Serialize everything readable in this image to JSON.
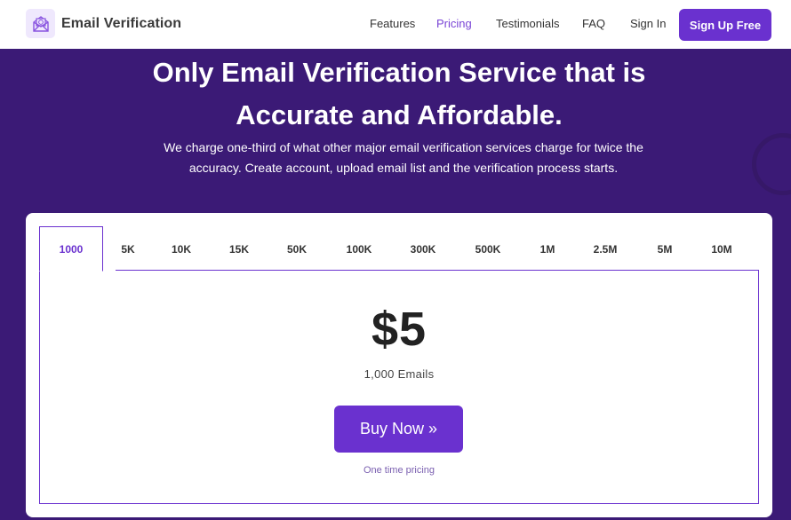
{
  "brand": {
    "name": "Email Verification",
    "logo_icon": "envelope-check-icon"
  },
  "nav": {
    "links": [
      {
        "label": "Features",
        "active": false
      },
      {
        "label": "Pricing",
        "active": true
      },
      {
        "label": "Testimonials",
        "active": false
      },
      {
        "label": "FAQ",
        "active": false
      },
      {
        "label": "Sign In",
        "active": false
      }
    ],
    "signup_label": "Sign Up Free"
  },
  "hero": {
    "title_line1": "Only Email Verification Service that is",
    "title_line2": "Accurate and Affordable.",
    "subtitle_line1": "We charge one-third of what other major email verification services charge for twice the",
    "subtitle_line2": "accuracy. Create account, upload email list and the verification process starts."
  },
  "pricing": {
    "tabs": [
      "1000",
      "5K",
      "10K",
      "15K",
      "50K",
      "100K",
      "300K",
      "500K",
      "1M",
      "2.5M",
      "5M",
      "10M"
    ],
    "active_tab": "1000",
    "price": "$5",
    "emails": "1,000 Emails",
    "buy_label": "Buy Now »",
    "note": "One time pricing"
  },
  "colors": {
    "brand": "#6a31cf",
    "hero_bg": "#3b1a76",
    "active_link": "#7a45d6"
  }
}
